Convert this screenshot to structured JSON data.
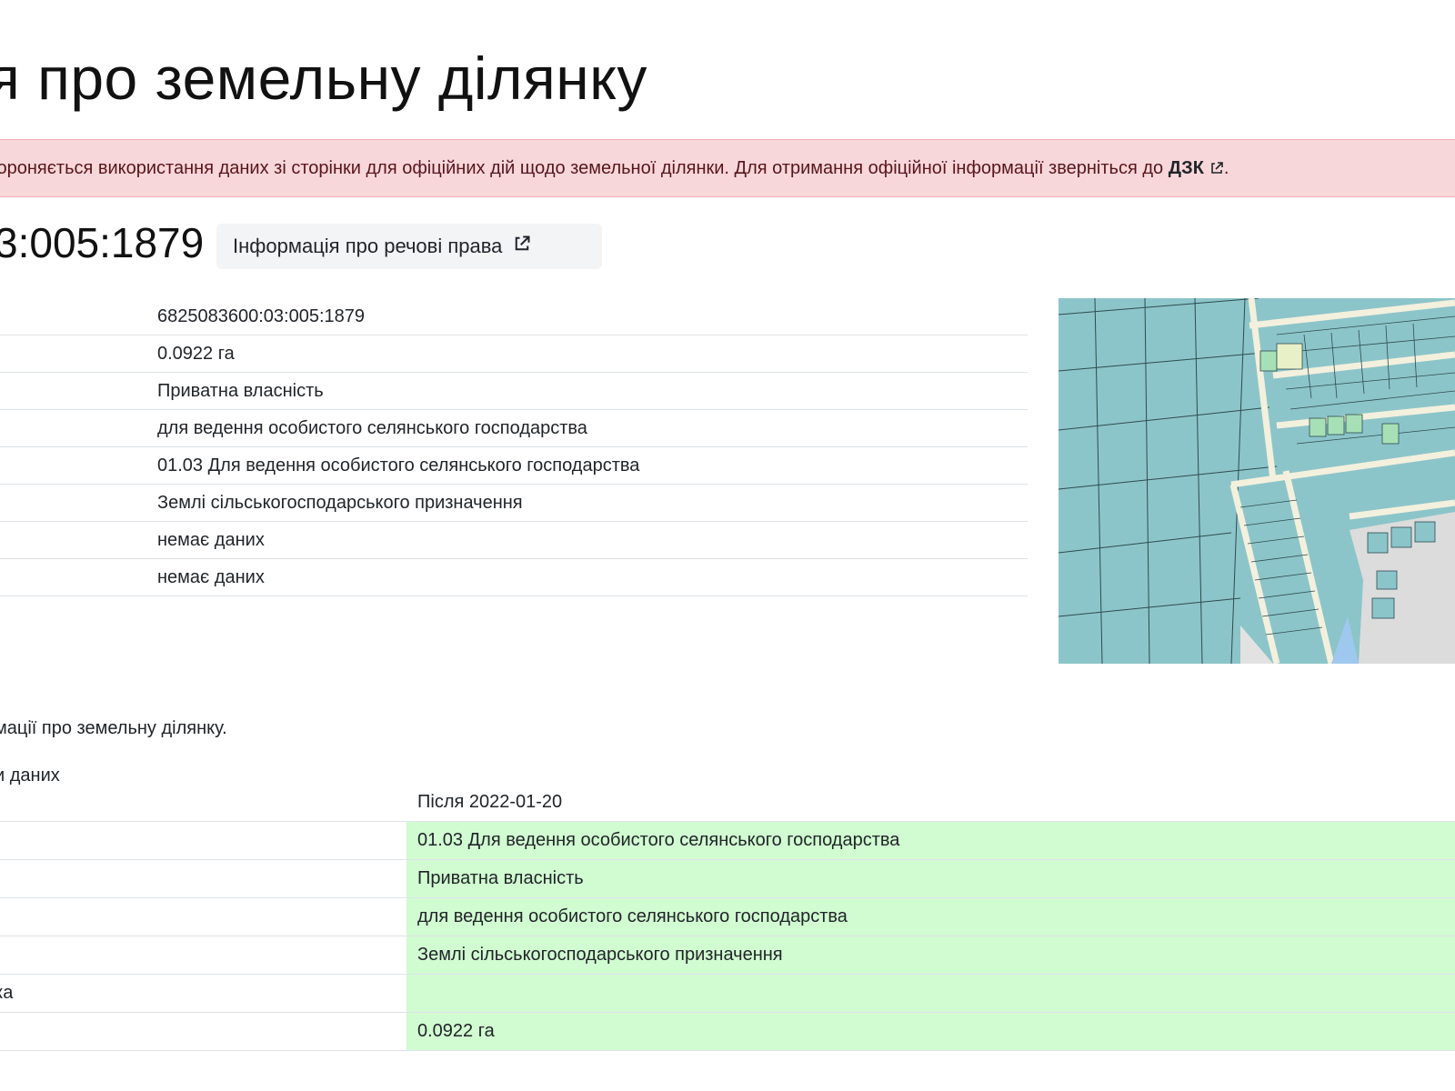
{
  "page": {
    "title": "я про земельну ділянку"
  },
  "alert": {
    "text": "бороняється використання даних зі сторінки для офіційних дій щодо земельної ділянки. Для отримання офіційної інформації зверніться до ",
    "link_label": "ДЗК",
    "suffix": ".",
    "background": "#f8d7da"
  },
  "parcel": {
    "cadastral_number": "3:005:1879",
    "rights_button_label": "Інформація про речові права",
    "rights_button_icon": "external-link-icon"
  },
  "info_rows": [
    "6825083600:03:005:1879",
    "0.0922 га",
    "Приватна власність",
    "для ведення особистого селянського господарства",
    "01.03 Для ведення особистого селянського господарства",
    "Землі сільськогосподарського призначення",
    "немає даних",
    "немає даних"
  ],
  "map": {
    "parcel_color": "#8cc5c9",
    "road_color": "#f3f0de",
    "highlight_color": "#a7e0b6"
  },
  "note": "мації про земельну ділянку.",
  "compare": {
    "title": "и даних",
    "header_value": "Після 2022-01-20",
    "changed_color": "#d1fbd1",
    "rows": [
      {
        "label": "",
        "value": "01.03 Для ведення особистого селянського господарства"
      },
      {
        "label": "",
        "value": "Приватна власність"
      },
      {
        "label": "",
        "value": "для ведення особистого селянського господарства"
      },
      {
        "label": "",
        "value": "Землі сільськогосподарського призначення"
      },
      {
        "label": "ка",
        "value": ""
      },
      {
        "label": "",
        "value": "0.0922 га"
      }
    ]
  }
}
